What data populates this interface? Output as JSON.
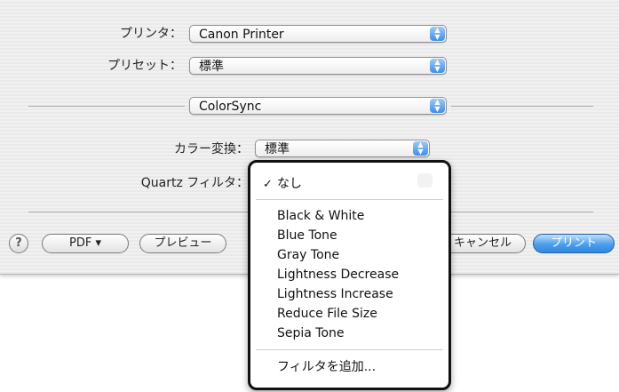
{
  "printer": {
    "label": "プリンタ：",
    "value": "Canon Printer"
  },
  "preset": {
    "label": "プリセット：",
    "value": "標準"
  },
  "panel": {
    "value": "ColorSync"
  },
  "color_conversion": {
    "label": "カラー変換：",
    "value": "標準"
  },
  "quartz_filter": {
    "label": "Quartz フィルタ："
  },
  "menu": {
    "checked": "なし",
    "check_mark": "✓",
    "items": [
      "Black & White",
      "Blue Tone",
      "Gray Tone",
      "Lightness Decrease",
      "Lightness Increase",
      "Reduce File Size",
      "Sepia Tone"
    ],
    "add_filter": "フィルタを追加..."
  },
  "buttons": {
    "help": "?",
    "pdf": "PDF ▾",
    "preview": "プレビュー",
    "cancel": "キャンセル",
    "print": "プリント"
  }
}
